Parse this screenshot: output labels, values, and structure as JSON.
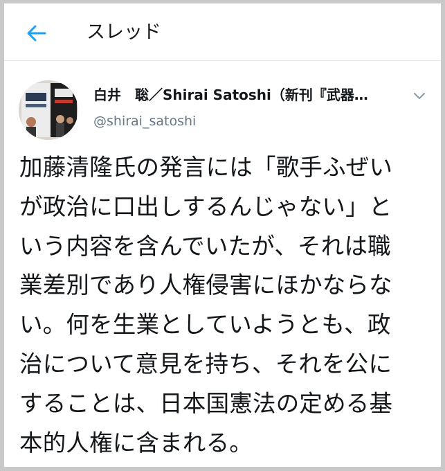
{
  "header": {
    "title": "スレッド",
    "back_icon": "arrow-left-icon",
    "accent_color": "#1da1f2"
  },
  "tweet": {
    "author_name": "白井　聡／Shirai Satoshi（新刊『武器…",
    "author_handle": "@shirai_satoshi",
    "menu_icon": "chevron-down-icon",
    "text_lines": [
      "加藤清隆氏の発言には「歌手ふぜい",
      "が政治に口出しするんじゃない」と",
      "いう内容を含んでいたが、それは職",
      "業差別であり人権侵害にほかならな",
      "い。何を生業としていようとも、政",
      "治について意見を持ち、それを公に",
      "することは、日本国憲法の定める基",
      "本的人権に含まれる。"
    ]
  }
}
